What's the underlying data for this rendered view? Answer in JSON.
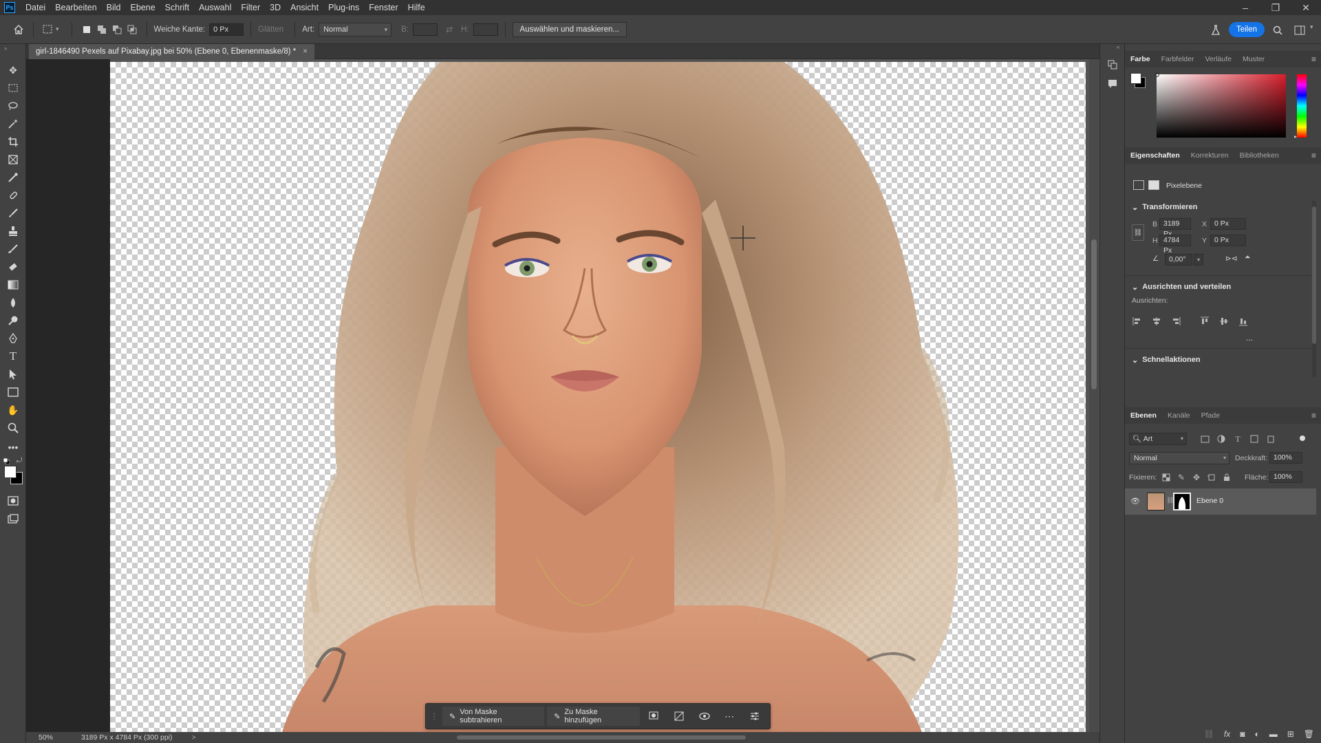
{
  "menu": {
    "logo": "Ps",
    "items": [
      "Datei",
      "Bearbeiten",
      "Bild",
      "Ebene",
      "Schrift",
      "Auswahl",
      "Filter",
      "3D",
      "Ansicht",
      "Plug-ins",
      "Fenster",
      "Hilfe"
    ]
  },
  "window_controls": [
    "–",
    "❐",
    "✕"
  ],
  "options": {
    "feather_label": "Weiche Kante:",
    "feather_value": "0 Px",
    "smooth_label": "Glätten",
    "style_label": "Art:",
    "style_value": "Normal",
    "width_label": "B:",
    "height_label": "H:",
    "select_mask_button": "Auswählen und maskieren...",
    "share_button": "Teilen"
  },
  "document": {
    "tab_title": "girl-1846490 Pexels auf Pixabay.jpg bei 50% (Ebene 0, Ebenenmaske/8) *",
    "close": "×"
  },
  "mask_taskbar": {
    "subtract": "Von Maske subtrahieren",
    "add": "Zu Maske hinzufügen"
  },
  "status": {
    "zoom": "50%",
    "info": "3189 Px x 4784 Px (300 ppi)",
    "arrow": ">"
  },
  "color_panel": {
    "tabs": [
      "Farbe",
      "Farbfelder",
      "Verläufe",
      "Muster"
    ],
    "active": 0,
    "hue_color": "#d81e2c"
  },
  "properties_panel": {
    "tabs": [
      "Eigenschaften",
      "Korrekturen",
      "Bibliotheken"
    ],
    "active": 0,
    "layer_type": "Pixelebene",
    "transform_title": "Transformieren",
    "w_label": "B",
    "w_value": "3189 Px",
    "h_label": "H",
    "h_value": "4784 Px",
    "x_label": "X",
    "x_value": "0 Px",
    "y_label": "Y",
    "y_value": "0 Px",
    "angle_value": "0,00°",
    "align_title": "Ausrichten und verteilen",
    "align_label": "Ausrichten:",
    "more": "...",
    "quick_actions_title": "Schnellaktionen"
  },
  "layers_panel": {
    "tabs": [
      "Ebenen",
      "Kanäle",
      "Pfade"
    ],
    "active": 0,
    "filter_value": "Art",
    "blend_mode": "Normal",
    "opacity_label": "Deckkraft:",
    "opacity_value": "100%",
    "lock_label": "Fixieren:",
    "fill_label": "Fläche:",
    "fill_value": "100%",
    "layer_name": "Ebene 0"
  }
}
